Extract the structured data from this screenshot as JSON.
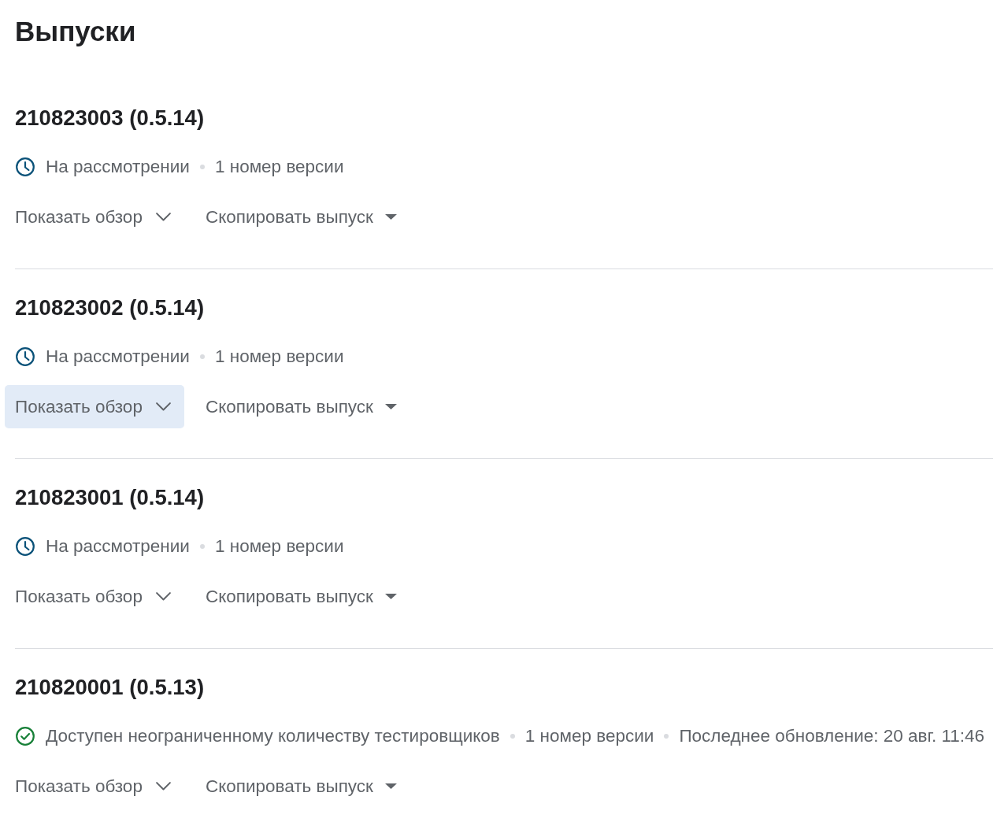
{
  "title": "Выпуски",
  "releases": [
    {
      "name": "210823003 (0.5.14)",
      "status": {
        "kind": "in_review",
        "label": "На рассмотрении"
      },
      "meta": [
        "1 номер версии"
      ],
      "overview_button": {
        "label": "Показать обзор",
        "hovered": false
      },
      "copy_button": {
        "label": "Скопировать выпуск"
      }
    },
    {
      "name": "210823002 (0.5.14)",
      "status": {
        "kind": "in_review",
        "label": "На рассмотрении"
      },
      "meta": [
        "1 номер версии"
      ],
      "overview_button": {
        "label": "Показать обзор",
        "hovered": true
      },
      "copy_button": {
        "label": "Скопировать выпуск"
      }
    },
    {
      "name": "210823001 (0.5.14)",
      "status": {
        "kind": "in_review",
        "label": "На рассмотрении"
      },
      "meta": [
        "1 номер версии"
      ],
      "overview_button": {
        "label": "Показать обзор",
        "hovered": false
      },
      "copy_button": {
        "label": "Скопировать выпуск"
      }
    },
    {
      "name": "210820001 (0.5.13)",
      "status": {
        "kind": "available",
        "label": "Доступен неограниченному количеству тестировщиков"
      },
      "meta": [
        "1 номер версии",
        "Последнее обновление: 20 авг. 11:46"
      ],
      "overview_button": {
        "label": "Показать обзор",
        "hovered": false
      },
      "copy_button": {
        "label": "Скопировать выпуск"
      }
    }
  ]
}
